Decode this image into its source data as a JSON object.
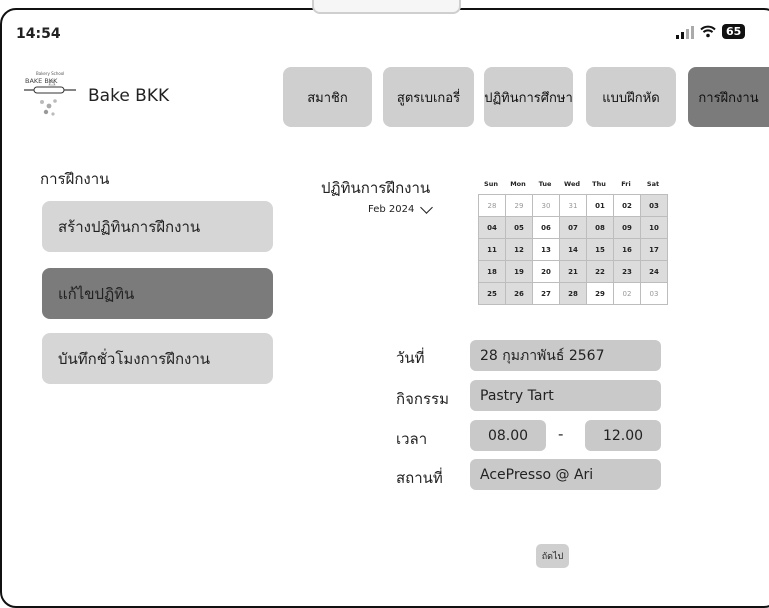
{
  "status": {
    "time": "14:54",
    "battery": "65"
  },
  "brand": {
    "name": "Bake BKK",
    "logo_text": "BAKE BKK"
  },
  "nav": [
    "สมาชิก",
    "สูตรเบเกอรี่",
    "ปฏิทินการศึกษา",
    "แบบฝึกหัด",
    "การฝึกงาน"
  ],
  "sidebar": {
    "title": "การฝึกงาน",
    "items": [
      "สร้างปฏิทินการฝึกงาน",
      "แก้ไขปฏิทิน",
      "บันทึกชั่วโมงการฝึกงาน"
    ]
  },
  "calendar": {
    "title": "ปฏิทินการฝึกงาน",
    "month": "Feb 2024",
    "weekdays": [
      "Sun",
      "Mon",
      "Tue",
      "Wed",
      "Thu",
      "Fri",
      "Sat"
    ],
    "days": [
      [
        "28",
        "29",
        "30",
        "31",
        "01",
        "02",
        "03"
      ],
      [
        "04",
        "05",
        "06",
        "07",
        "08",
        "09",
        "10"
      ],
      [
        "11",
        "12",
        "13",
        "14",
        "15",
        "16",
        "17"
      ],
      [
        "18",
        "19",
        "20",
        "21",
        "22",
        "23",
        "24"
      ],
      [
        "25",
        "26",
        "27",
        "28",
        "29",
        "02",
        "03"
      ]
    ]
  },
  "form": {
    "date_label": "วันที่",
    "date_value": "28 กุมภาพันธ์ 2567",
    "activity_label": "กิจกรรม",
    "activity_value": "Pastry Tart",
    "time_label": "เวลา",
    "time_start": "08.00",
    "time_sep": "-",
    "time_end": "12.00",
    "place_label": "สถานที่",
    "place_value": "AcePresso @ Ari"
  },
  "next_label": "ถัดไป"
}
